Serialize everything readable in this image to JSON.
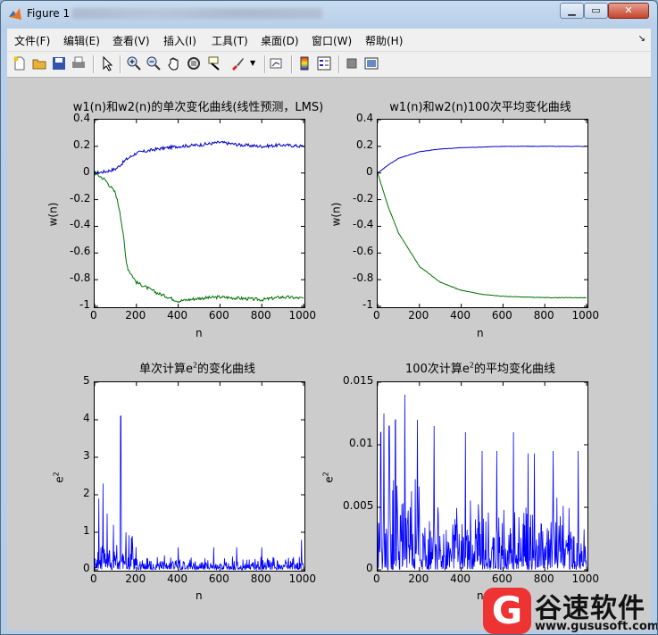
{
  "window": {
    "title": "Figure 1"
  },
  "menu": [
    "文件(F)",
    "编辑(E)",
    "查看(V)",
    "插入(I)",
    "工具(T)",
    "桌面(D)",
    "窗口(W)",
    "帮助(H)"
  ],
  "toolbar_icons": [
    "new-figure-icon",
    "open-file-icon",
    "save-icon",
    "print-icon",
    "edit-plot-icon",
    "zoom-in-icon",
    "zoom-out-icon",
    "pan-icon",
    "rotate-3d-icon",
    "data-cursor-icon",
    "brush-icon",
    "link-plot-icon",
    "insert-colorbar-icon",
    "insert-legend-icon",
    "hide-plot-tools-icon",
    "show-plot-tools-icon"
  ],
  "colors": {
    "series1": "#0000c8",
    "series2": "#007000",
    "e2": "#0000ff",
    "figure_bg": "#cccccc"
  },
  "plots": {
    "p1": {
      "title": "w1(n)和w2(n)的单次变化曲线(线性预测，LMS)",
      "xlabel": "n",
      "ylabel": "w(n)",
      "xticks": [
        "0",
        "200",
        "400",
        "600",
        "800",
        "1000"
      ],
      "yticks": [
        "0.4",
        "0.2",
        "0",
        "-0.2",
        "-0.4",
        "-0.6",
        "-0.8",
        "-1"
      ]
    },
    "p2": {
      "title": "w1(n)和w2(n)100次平均变化曲线",
      "xlabel": "n",
      "ylabel": "w(n)",
      "xticks": [
        "0",
        "200",
        "400",
        "600",
        "800",
        "1000"
      ],
      "yticks": [
        "0.4",
        "0.2",
        "0",
        "-0.2",
        "-0.4",
        "-0.6",
        "-0.8",
        "-1"
      ]
    },
    "p3": {
      "title_pre": "单次计算e",
      "title_sup": "2",
      "title_post": "的变化曲线",
      "xlabel": "n",
      "ylabel_base": "e",
      "ylabel_sup": "2",
      "xticks": [
        "0",
        "200",
        "400",
        "600",
        "800",
        "1000"
      ],
      "yticks": [
        "5",
        "4",
        "3",
        "2",
        "1",
        "0"
      ]
    },
    "p4": {
      "title_pre": "100次计算e",
      "title_sup": "2",
      "title_post": "的平均变化曲线",
      "xlabel": "n",
      "ylabel_base": "e",
      "ylabel_sup": "2",
      "xticks": [
        "0",
        "200",
        "400",
        "600",
        "800",
        "1000"
      ],
      "yticks": [
        "0.015",
        "0.01",
        "0.005",
        "0"
      ]
    }
  },
  "chart_data": [
    {
      "type": "line",
      "title": "w1(n)和w2(n)的单次变化曲线(线性预测，LMS)",
      "xlabel": "n",
      "ylabel": "w(n)",
      "xlim": [
        0,
        1000
      ],
      "ylim": [
        -1,
        0.4
      ],
      "series": [
        {
          "x": [
            0,
            50,
            100,
            130,
            150,
            200,
            300,
            400,
            500,
            600,
            700,
            800,
            900,
            1000
          ],
          "values": [
            0,
            0.01,
            0.03,
            0.07,
            0.1,
            0.15,
            0.18,
            0.2,
            0.21,
            0.23,
            0.21,
            0.2,
            0.21,
            0.2
          ]
        },
        {
          "x": [
            0,
            50,
            100,
            120,
            140,
            150,
            160,
            200,
            300,
            400,
            500,
            600,
            700,
            800,
            900,
            1000
          ],
          "values": [
            0,
            -0.05,
            -0.15,
            -0.28,
            -0.5,
            -0.65,
            -0.72,
            -0.82,
            -0.9,
            -0.96,
            -0.94,
            -0.93,
            -0.94,
            -0.95,
            -0.93,
            -0.94
          ]
        }
      ]
    },
    {
      "type": "line",
      "title": "w1(n)和w2(n)100次平均变化曲线",
      "xlabel": "n",
      "ylabel": "w(n)",
      "xlim": [
        0,
        1000
      ],
      "ylim": [
        -1,
        0.4
      ],
      "series": [
        {
          "x": [
            0,
            50,
            100,
            200,
            300,
            400,
            500,
            600,
            700,
            800,
            900,
            1000
          ],
          "values": [
            0,
            0.06,
            0.11,
            0.16,
            0.18,
            0.19,
            0.195,
            0.2,
            0.2,
            0.2,
            0.2,
            0.2
          ]
        },
        {
          "x": [
            0,
            50,
            100,
            200,
            300,
            400,
            500,
            600,
            700,
            800,
            900,
            1000
          ],
          "values": [
            0,
            -0.25,
            -0.45,
            -0.7,
            -0.82,
            -0.88,
            -0.91,
            -0.925,
            -0.93,
            -0.935,
            -0.935,
            -0.935
          ]
        }
      ]
    },
    {
      "type": "line",
      "title": "单次计算e²的变化曲线",
      "xlabel": "n",
      "ylabel": "e²",
      "xlim": [
        0,
        1000
      ],
      "ylim": [
        0,
        5
      ],
      "peaks": {
        "x": [
          20,
          40,
          60,
          90,
          125,
          150,
          400,
          570,
          680,
          800,
          990
        ],
        "values": [
          1.9,
          2.3,
          1.5,
          1.2,
          4.1,
          1.0,
          0.6,
          0.6,
          0.6,
          0.6,
          0.8
        ]
      },
      "baseline_max": 0.4
    },
    {
      "type": "line",
      "title": "100次计算e²的平均变化曲线",
      "xlabel": "n",
      "ylabel": "e²",
      "xlim": [
        0,
        1000
      ],
      "ylim": [
        0,
        0.015
      ],
      "peaks": {
        "x": [
          15,
          30,
          55,
          85,
          130,
          190,
          270,
          420,
          500,
          570,
          650,
          720,
          750,
          840,
          960
        ],
        "values": [
          0.011,
          0.0125,
          0.0115,
          0.012,
          0.014,
          0.012,
          0.0115,
          0.011,
          0.0095,
          0.0095,
          0.011,
          0.0093,
          0.0093,
          0.0095,
          0.0095
        ]
      },
      "baseline_max": 0.006
    }
  ],
  "watermark": {
    "glyph": "G",
    "name": "谷速软件",
    "url": "www.gususoft.com"
  }
}
